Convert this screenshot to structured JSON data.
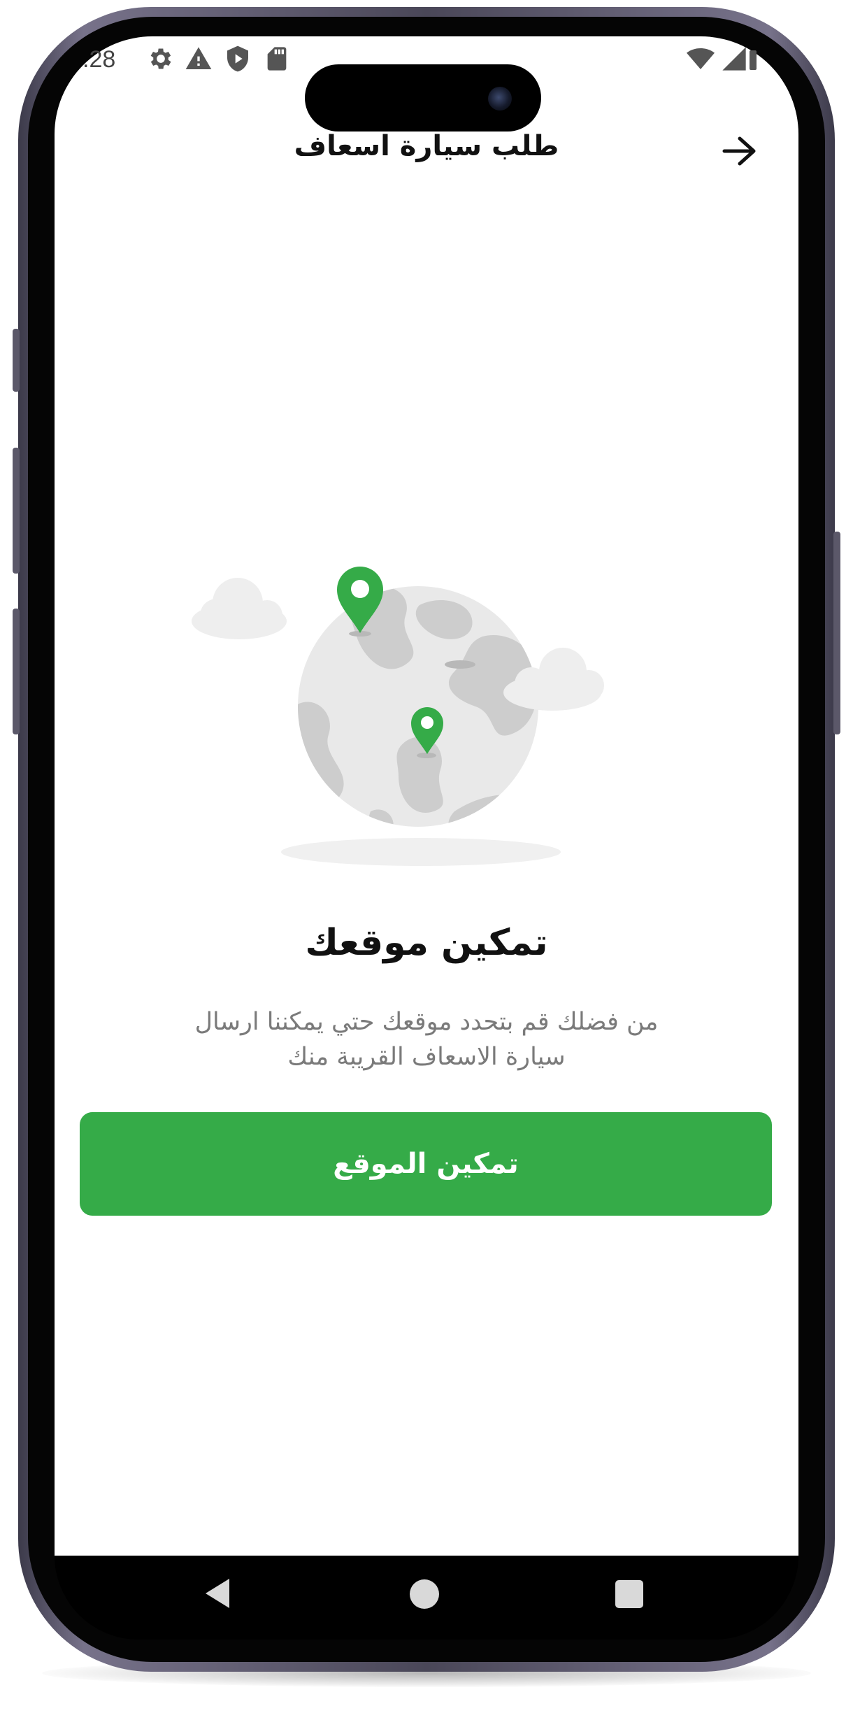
{
  "status_bar": {
    "time": ".28",
    "icons": [
      "gear-icon",
      "warning-icon",
      "shield-play-icon",
      "sd-card-icon",
      "wifi-icon",
      "cell-signal-icon",
      "battery-icon"
    ]
  },
  "header": {
    "title": "طلب سيارة اسعاف",
    "back_icon": "arrow-right-icon"
  },
  "illustration": {
    "description_icon": "globe-with-location-pins-icon",
    "pin_color": "#35ab48"
  },
  "content": {
    "heading": "تمكين موقعك",
    "description_line1": "من فضلك قم بتحدد موقعك حتي يمكننا ارسال",
    "description_line2": "سيارة الاسعاف القريبة منك"
  },
  "actions": {
    "enable_location_label": "تمكين الموقع"
  },
  "colors": {
    "accent": "#35ab48",
    "text_primary": "#111111",
    "text_secondary": "#7a7a7a"
  },
  "system_nav": {
    "icons": [
      "nav-back-icon",
      "nav-home-icon",
      "nav-recents-icon"
    ]
  }
}
